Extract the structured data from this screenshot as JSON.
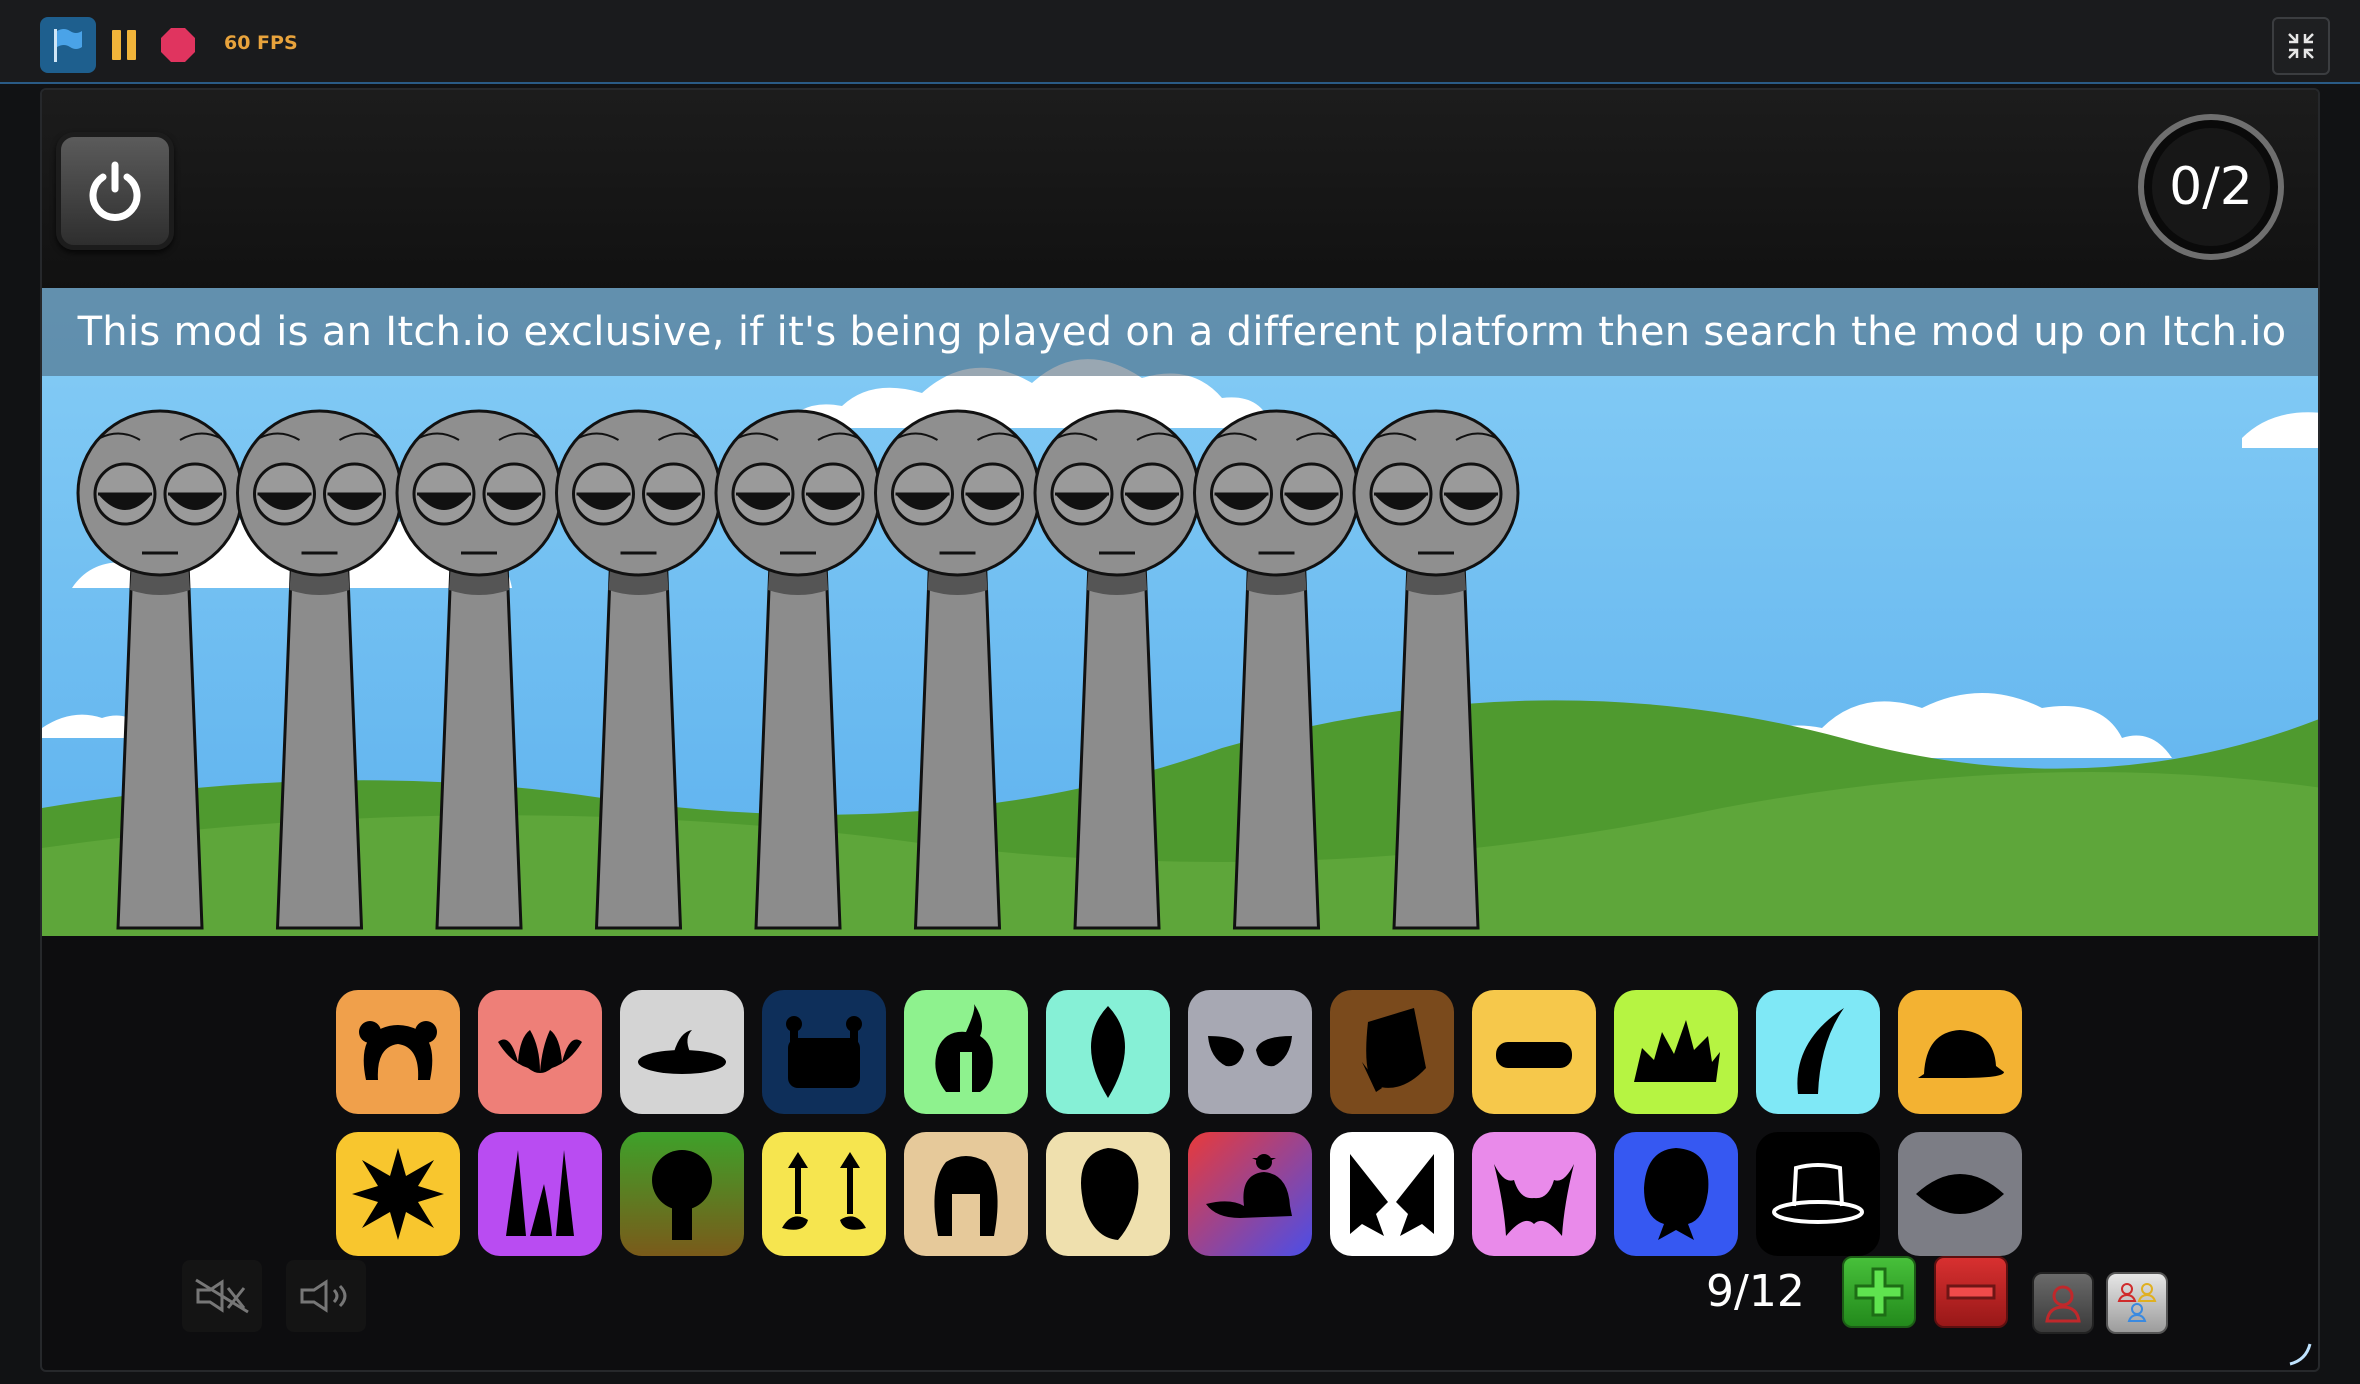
{
  "toolbar": {
    "fps_label": "60 FPS",
    "icons": [
      "green-flag-icon",
      "pause-icon",
      "stop-icon",
      "exit-fullscreen-icon"
    ]
  },
  "stage": {
    "power_icon": "power-icon",
    "score": "0/2",
    "notice": "This mod is an Itch.io exclusive, if it's being played on a different platform then search the mod up on Itch.io",
    "character_count": 9
  },
  "palette": {
    "row1": [
      {
        "icon": "ears-icon",
        "color": "#f0a04b"
      },
      {
        "icon": "fangs-icon",
        "color": "#ee7f78"
      },
      {
        "icon": "ufo-hat-icon",
        "color": "#d4d4d4"
      },
      {
        "icon": "robot-head-icon",
        "color": "#0e2f5a"
      },
      {
        "icon": "hair-curl-icon",
        "color": "#8ef28e"
      },
      {
        "icon": "leaf-icon",
        "color": "#86f0d6"
      },
      {
        "icon": "alien-eyes-icon",
        "color": "#a7a8b3"
      },
      {
        "icon": "bucket-icon",
        "color": "#7a4a1c"
      },
      {
        "icon": "visor-icon",
        "color": "#f6c84b"
      },
      {
        "icon": "crown-icon",
        "color": "#b6f442"
      },
      {
        "icon": "horn-icon",
        "color": "#7fe8f6"
      },
      {
        "icon": "bowler-hat-icon",
        "color": "#f3b232"
      }
    ],
    "row2": [
      {
        "icon": "star-burst-icon",
        "color": "#f8c62e"
      },
      {
        "icon": "spikes-icon",
        "color": "#b94cf2"
      },
      {
        "icon": "tree-head-icon",
        "color": "#4d9c2c"
      },
      {
        "icon": "antenna-icon",
        "color": "#f6e54f"
      },
      {
        "icon": "hood-icon",
        "color": "#e6c99a"
      },
      {
        "icon": "egg-head-icon",
        "color": "#efe0ae"
      },
      {
        "icon": "cap-icon",
        "color": "#d43b4b"
      },
      {
        "icon": "wings-icon",
        "color": "#ffffff"
      },
      {
        "icon": "mustache-icon",
        "color": "#e98aea"
      },
      {
        "icon": "round-head-icon",
        "color": "#3658f2"
      },
      {
        "icon": "top-hat-icon",
        "color": "#000000"
      },
      {
        "icon": "eye-shape-icon",
        "color": "#7c7d85"
      }
    ]
  },
  "controls": {
    "count": "9/12",
    "icons": [
      "mute-visuals-icon",
      "sound-icon",
      "add-icon",
      "remove-icon",
      "character-icon",
      "multi-character-icon"
    ]
  }
}
